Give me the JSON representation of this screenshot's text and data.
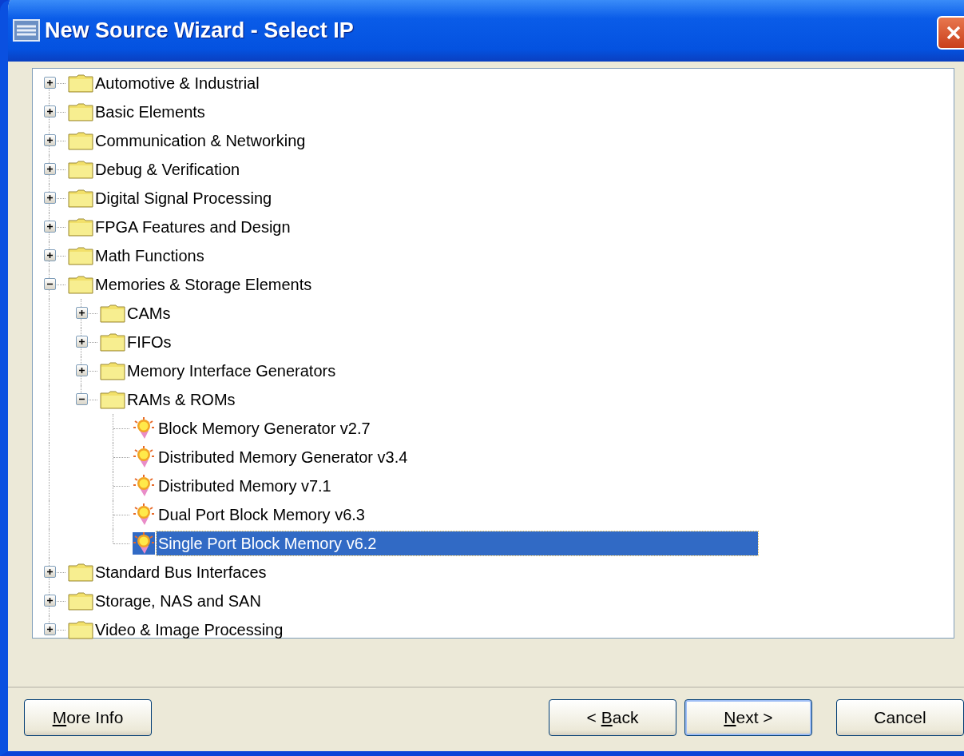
{
  "window": {
    "title": "New Source Wizard - Select IP"
  },
  "tree": [
    {
      "label": "Automotive & Industrial",
      "kind": "folder",
      "expanded": false,
      "selected": false
    },
    {
      "label": "Basic Elements",
      "kind": "folder",
      "expanded": false,
      "selected": false
    },
    {
      "label": "Communication & Networking",
      "kind": "folder",
      "expanded": false,
      "selected": false
    },
    {
      "label": "Debug & Verification",
      "kind": "folder",
      "expanded": false,
      "selected": false
    },
    {
      "label": "Digital Signal Processing",
      "kind": "folder",
      "expanded": false,
      "selected": false
    },
    {
      "label": "FPGA Features and Design",
      "kind": "folder",
      "expanded": false,
      "selected": false
    },
    {
      "label": "Math Functions",
      "kind": "folder",
      "expanded": false,
      "selected": false
    },
    {
      "label": "Memories & Storage Elements",
      "kind": "folder",
      "expanded": true,
      "selected": false,
      "children": [
        {
          "label": "CAMs",
          "kind": "folder",
          "expanded": false,
          "selected": false
        },
        {
          "label": "FIFOs",
          "kind": "folder",
          "expanded": false,
          "selected": false
        },
        {
          "label": "Memory Interface Generators",
          "kind": "folder",
          "expanded": false,
          "selected": false
        },
        {
          "label": "RAMs & ROMs",
          "kind": "folder",
          "expanded": true,
          "selected": false,
          "children": [
            {
              "label": "Block Memory Generator v2.7",
              "kind": "ip",
              "selected": false
            },
            {
              "label": "Distributed Memory Generator v3.4",
              "kind": "ip",
              "selected": false
            },
            {
              "label": "Distributed Memory v7.1",
              "kind": "ip",
              "selected": false
            },
            {
              "label": "Dual Port Block Memory v6.3",
              "kind": "ip",
              "selected": false
            },
            {
              "label": "Single Port Block Memory v6.2",
              "kind": "ip",
              "selected": true
            }
          ]
        }
      ]
    },
    {
      "label": "Standard Bus Interfaces",
      "kind": "folder",
      "expanded": false,
      "selected": false
    },
    {
      "label": "Storage, NAS and SAN",
      "kind": "folder",
      "expanded": false,
      "selected": false
    },
    {
      "label": "Video & Image Processing",
      "kind": "folder",
      "expanded": false,
      "selected": false
    }
  ],
  "buttons": [
    {
      "key": "M",
      "rest": "ore Info",
      "default": false
    },
    {
      "before": "< ",
      "key": "B",
      "rest": "ack",
      "default": false
    },
    {
      "key": "N",
      "rest": "ext >",
      "default": true
    },
    {
      "rest": "Cancel",
      "default": false
    }
  ]
}
